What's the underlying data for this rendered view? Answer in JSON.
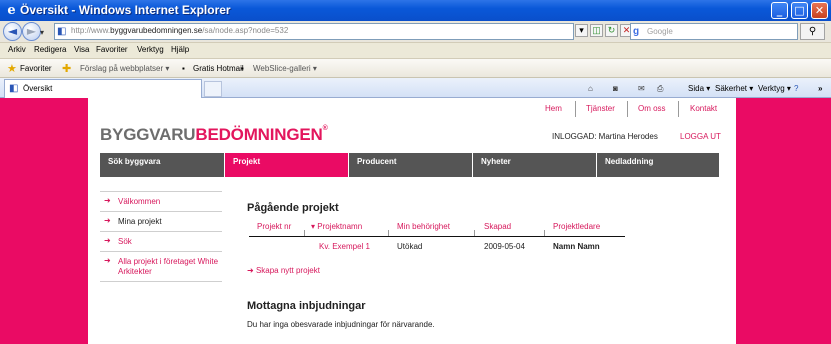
{
  "window": {
    "title": "Översikt - Windows Internet Explorer",
    "buttons": {
      "minimize": "_",
      "maximize": "□",
      "close": "✕"
    }
  },
  "address": {
    "url_prefix": "http://www.",
    "url_domain": "byggvarubedomningen.se",
    "url_path": "/sa/node.asp?node=532",
    "search_placeholder": "Google"
  },
  "menu": [
    "Arkiv",
    "Redigera",
    "Visa",
    "Favoriter",
    "Verktyg",
    "Hjälp"
  ],
  "favorites": {
    "favorites_label": "Favoriter",
    "items": [
      "Förslag på webbplatser ▾",
      "Gratis Hotmail",
      "WebSlice-galleri ▾"
    ]
  },
  "tab": {
    "title": "Översikt"
  },
  "commandbar": {
    "page": "Sida ▾",
    "safety": "Säkerhet ▾",
    "tools": "Verktyg ▾",
    "more": "»"
  },
  "site": {
    "top_links": [
      "Hem",
      "Tjänster",
      "Om oss",
      "Kontakt"
    ],
    "logo_part1": "BYGGVARU",
    "logo_part2": "BEDÖMNINGEN",
    "logo_tm": "®",
    "logged_in": "INLOGGAD: Martina Herodes",
    "logout": "LOGGA UT",
    "nav": [
      "Sök byggvara",
      "Projekt",
      "Producent",
      "Nyheter",
      "Nedladdning"
    ],
    "active_nav": "Projekt",
    "side_nav": [
      "Välkommen",
      "Mina projekt",
      "Sök",
      "Alla projekt i företaget White Arkitekter"
    ],
    "active_side": "Mina projekt",
    "section_title": "Pågående projekt",
    "table": {
      "headers": [
        "Projekt nr",
        "▾ Projektnamn",
        "Min behörighet",
        "Skapad",
        "Projektledare"
      ],
      "rows": [
        {
          "nr": "",
          "name": "Kv. Exempel 1",
          "role": "Utökad",
          "created": "2009-05-04",
          "leader": "Namn Namn"
        }
      ]
    },
    "new_project": "Skapa nytt projekt",
    "invites_title": "Mottagna inbjudningar",
    "invites_text": "Du har inga obesvarade inbjudningar för närvarande."
  }
}
